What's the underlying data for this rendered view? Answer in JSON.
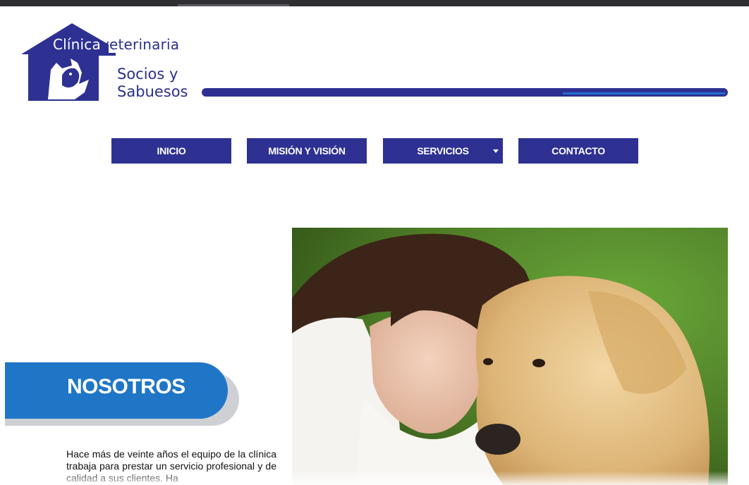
{
  "brand": {
    "line1_part_white": "Clínica",
    "line1_part_blue": "veterinaria",
    "line2": "Socios y",
    "line3": "Sabuesos",
    "color": "#2e3192"
  },
  "nav": {
    "items": [
      {
        "label": "INICIO"
      },
      {
        "label": "MISIÓN Y VISIÓN"
      },
      {
        "label": "SERVICIOS",
        "has_dropdown": true
      },
      {
        "label": "CONTACTO"
      }
    ]
  },
  "hero": {
    "image_icon": "woman-with-golden-retriever-photo"
  },
  "about": {
    "title": "NOSOTROS",
    "body": "Hace más de veinte años el equipo de la clínica trabaja para prestar un servicio profesional y de calidad a sus clientes. Ha"
  },
  "colors": {
    "primary": "#2e3192",
    "accent": "#1f76c6"
  }
}
